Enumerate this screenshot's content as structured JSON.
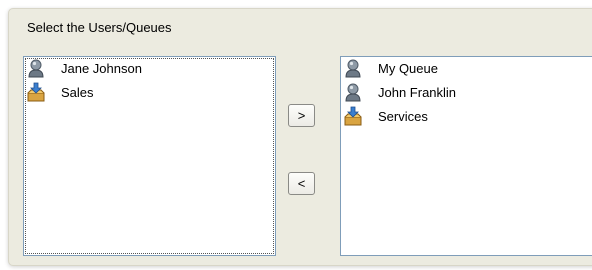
{
  "group_title": "Select the Users/Queues",
  "left_list": {
    "items": [
      {
        "label": "Jane Johnson",
        "icon": "user-icon"
      },
      {
        "label": "Sales",
        "icon": "queue-inbox-icon"
      }
    ]
  },
  "right_list": {
    "items": [
      {
        "label": "My Queue",
        "icon": "user-icon"
      },
      {
        "label": "John Franklin",
        "icon": "user-icon"
      },
      {
        "label": "Services",
        "icon": "queue-inbox-icon"
      }
    ]
  },
  "buttons": {
    "add_label": ">",
    "remove_label": "<"
  },
  "colors": {
    "panel_bg": "#ecebe0",
    "list_border": "#7f9db9"
  }
}
